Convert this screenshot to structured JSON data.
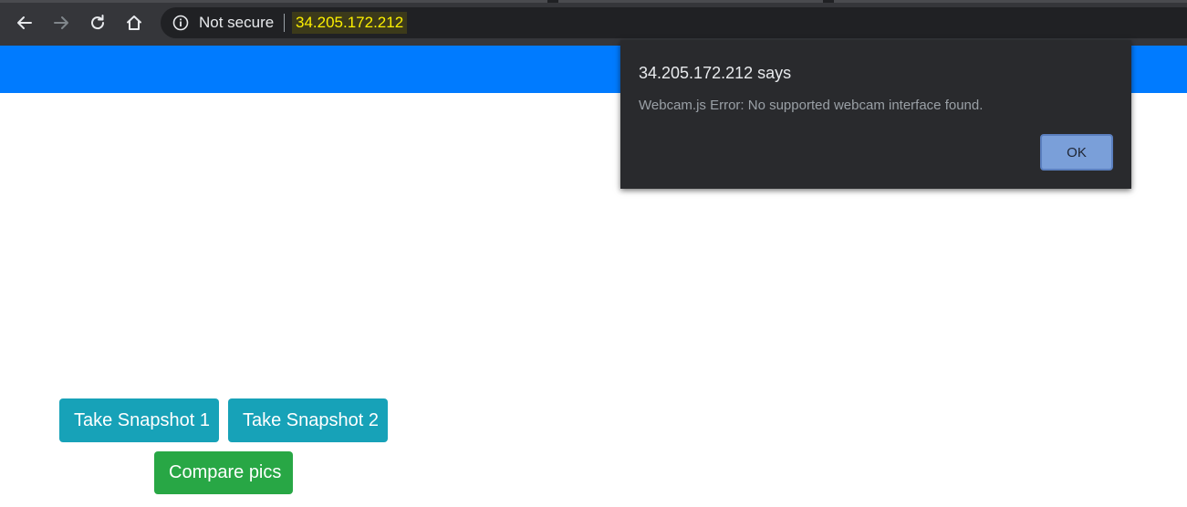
{
  "browser": {
    "address_bar": {
      "security_label": "Not secure",
      "url": "34.205.172.212"
    },
    "icons": {
      "back": "back-arrow-icon",
      "forward": "forward-arrow-icon",
      "reload": "reload-icon",
      "home": "home-icon",
      "site_info": "info-icon"
    }
  },
  "alert": {
    "title": "34.205.172.212 says",
    "message": "Webcam.js Error: No supported webcam interface found.",
    "ok_label": "OK"
  },
  "page": {
    "buttons": {
      "snapshot1": "Take Snapshot 1",
      "snapshot2": "Take Snapshot 2",
      "compare": "Compare pics"
    }
  },
  "colors": {
    "header": "#007bff",
    "info_button": "#17a2b8",
    "success_button": "#28a745",
    "url_highlight": "#fdf000"
  }
}
